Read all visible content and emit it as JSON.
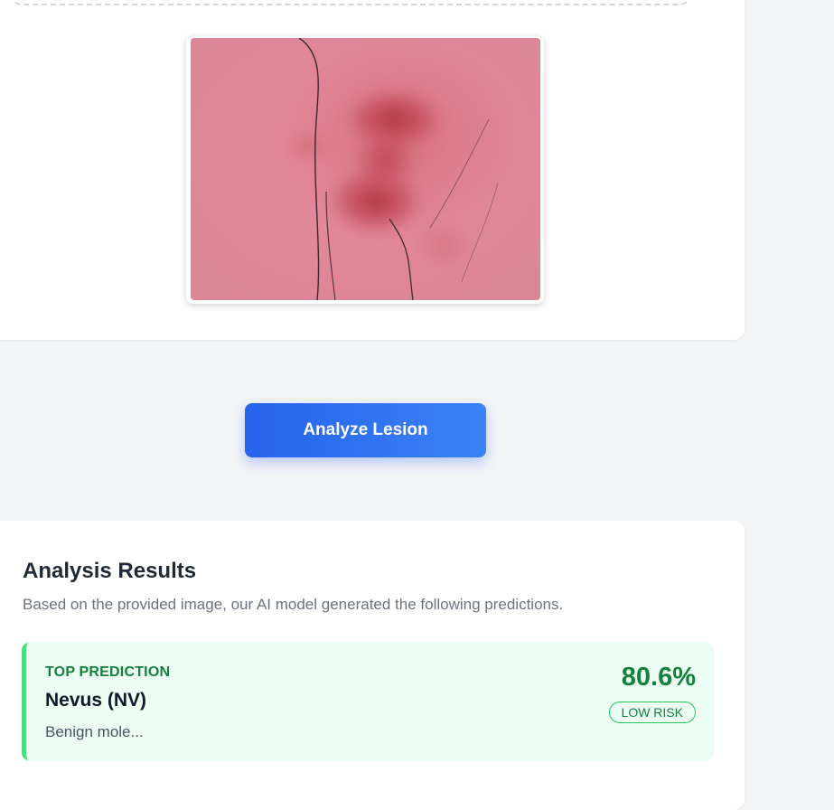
{
  "upload": {
    "preview_alt": "Uploaded skin lesion image"
  },
  "actions": {
    "analyze_label": "Analyze Lesion"
  },
  "results": {
    "title": "Analysis Results",
    "subtitle": "Based on the provided image, our AI model generated the following predictions.",
    "top_prediction": {
      "label": "TOP PREDICTION",
      "name": "Nevus (NV)",
      "description": "Benign mole...",
      "confidence": "80.6%",
      "risk": "LOW RISK"
    }
  },
  "colors": {
    "primary": "#2563eb",
    "success": "#15803d",
    "success_bg": "#ecfdf3",
    "success_border": "#4ade80"
  }
}
